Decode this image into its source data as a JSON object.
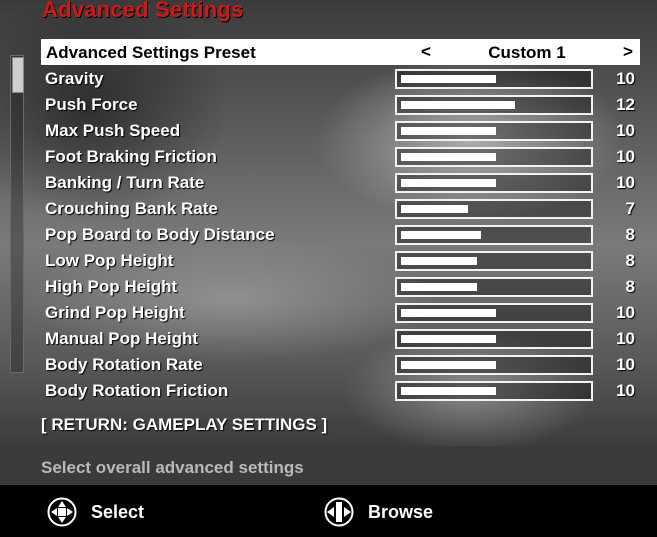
{
  "screen": {
    "title": "Advanced Settings"
  },
  "preset": {
    "label": "Advanced Settings Preset",
    "left_arrow": "<",
    "value": "Custom 1",
    "right_arrow": ">"
  },
  "settings": [
    {
      "label": "Gravity",
      "value": "10",
      "level": 0.5
    },
    {
      "label": "Push Force",
      "value": "12",
      "level": 0.6
    },
    {
      "label": "Max Push Speed",
      "value": "10",
      "level": 0.5
    },
    {
      "label": "Foot Braking Friction",
      "value": "10",
      "level": 0.5
    },
    {
      "label": "Banking / Turn Rate",
      "value": "10",
      "level": 0.5
    },
    {
      "label": "Crouching Bank Rate",
      "value": "7",
      "level": 0.35
    },
    {
      "label": "Pop Board to Body Distance",
      "value": "8",
      "level": 0.42
    },
    {
      "label": "Low Pop Height",
      "value": "8",
      "level": 0.4
    },
    {
      "label": "High Pop Height",
      "value": "8",
      "level": 0.4
    },
    {
      "label": "Grind Pop Height",
      "value": "10",
      "level": 0.5
    },
    {
      "label": "Manual Pop Height",
      "value": "10",
      "level": 0.5
    },
    {
      "label": "Body Rotation Rate",
      "value": "10",
      "level": 0.5
    },
    {
      "label": "Body Rotation Friction",
      "value": "10",
      "level": 0.5
    }
  ],
  "return_link": "[ RETURN: GAMEPLAY SETTINGS ]",
  "help_text": "Select overall advanced settings",
  "footer": {
    "select_label": "Select",
    "browse_label": "Browse",
    "select_icon": "dpad-icon",
    "browse_icon": "dpad-horizontal-icon"
  },
  "colors": {
    "title": "#d01818",
    "highlight": "#ffffff"
  }
}
